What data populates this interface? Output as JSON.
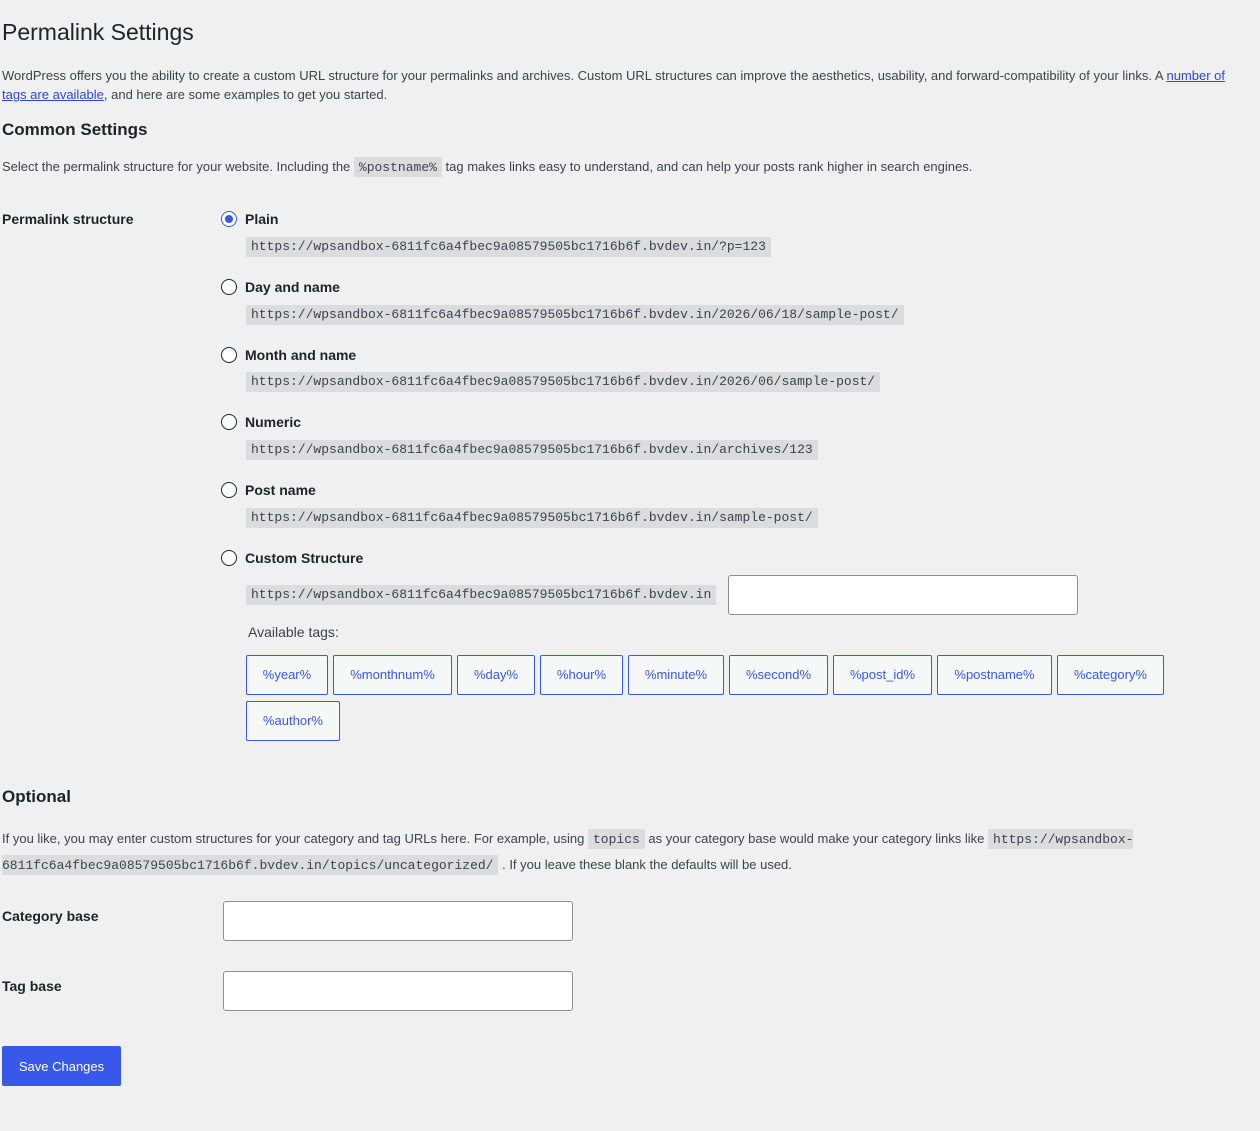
{
  "page_title": "Permalink Settings",
  "intro": {
    "text_before": "WordPress offers you the ability to create a custom URL structure for your permalinks and archives. Custom URL structures can improve the aesthetics, usability, and forward-compatibility of your links. A ",
    "link": "number of tags are available",
    "text_after": ", and here are some examples to get you started."
  },
  "common": {
    "title": "Common Settings",
    "desc_before": "Select the permalink structure for your website. Including the ",
    "desc_code": "%postname%",
    "desc_after": " tag makes links easy to understand, and can help your posts rank higher in search engines.",
    "structure_label": "Permalink structure",
    "options": [
      {
        "label": "Plain",
        "example": "https://wpsandbox-6811fc6a4fbec9a08579505bc1716b6f.bvdev.in/?p=123",
        "checked": true
      },
      {
        "label": "Day and name",
        "example": "https://wpsandbox-6811fc6a4fbec9a08579505bc1716b6f.bvdev.in/2026/06/18/sample-post/",
        "checked": false
      },
      {
        "label": "Month and name",
        "example": "https://wpsandbox-6811fc6a4fbec9a08579505bc1716b6f.bvdev.in/2026/06/sample-post/",
        "checked": false
      },
      {
        "label": "Numeric",
        "example": "https://wpsandbox-6811fc6a4fbec9a08579505bc1716b6f.bvdev.in/archives/123",
        "checked": false
      },
      {
        "label": "Post name",
        "example": "https://wpsandbox-6811fc6a4fbec9a08579505bc1716b6f.bvdev.in/sample-post/",
        "checked": false
      },
      {
        "label": "Custom Structure",
        "example": "https://wpsandbox-6811fc6a4fbec9a08579505bc1716b6f.bvdev.in",
        "checked": false
      }
    ],
    "custom_value": "",
    "available_tags_label": "Available tags:",
    "tags": [
      "%year%",
      "%monthnum%",
      "%day%",
      "%hour%",
      "%minute%",
      "%second%",
      "%post_id%",
      "%postname%",
      "%category%",
      "%author%"
    ]
  },
  "optional": {
    "title": "Optional",
    "desc_before": "If you like, you may enter custom structures for your category and tag URLs here. For example, using ",
    "desc_code1": "topics",
    "desc_middle": " as your category base would make your category links like ",
    "desc_code2": "https://wpsandbox-6811fc6a4fbec9a08579505bc1716b6f.bvdev.in/topics/uncategorized/",
    "desc_after": " . If you leave these blank the defaults will be used.",
    "category_label": "Category base",
    "category_value": "",
    "tag_label": "Tag base",
    "tag_value": ""
  },
  "save_label": "Save Changes",
  "colors": {
    "accent": "#3858e9",
    "background": "#f0f0f1",
    "code_bg": "#dcdcde"
  }
}
